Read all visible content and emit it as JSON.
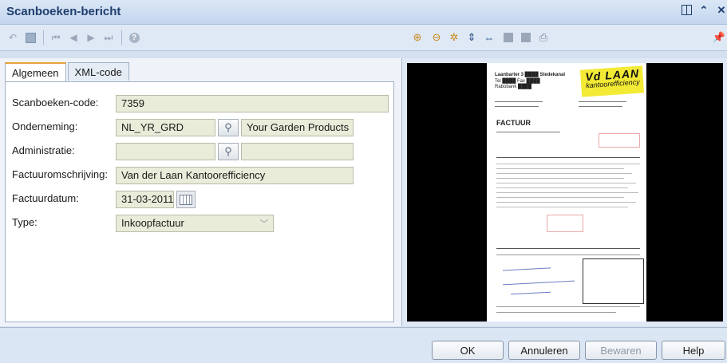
{
  "window": {
    "title": "Scanboeken-bericht"
  },
  "tabs": [
    {
      "label": "Algemeen"
    },
    {
      "label": "XML-code"
    }
  ],
  "form": {
    "scanboeken_code": {
      "label": "Scanboeken-code:",
      "value": "7359"
    },
    "onderneming": {
      "label": "Onderneming:",
      "code": "NL_YR_GRD",
      "name": "Your Garden Products"
    },
    "administratie": {
      "label": "Administratie:",
      "code": "",
      "name": ""
    },
    "factuuromschrijving": {
      "label": "Factuuromschrijving:",
      "value": "Van der Laan Kantoorefficiency"
    },
    "factuurdatum": {
      "label": "Factuurdatum:",
      "value": "31-03-2011"
    },
    "type": {
      "label": "Type:",
      "value": "Inkoopfactuur"
    }
  },
  "document": {
    "logo_line1": "Vd LAAN",
    "logo_line2": "kantoorefficiency",
    "heading": "FACTUUR"
  },
  "buttons": {
    "ok": "OK",
    "annuleren": "Annuleren",
    "bewaren": "Bewaren",
    "help": "Help"
  }
}
